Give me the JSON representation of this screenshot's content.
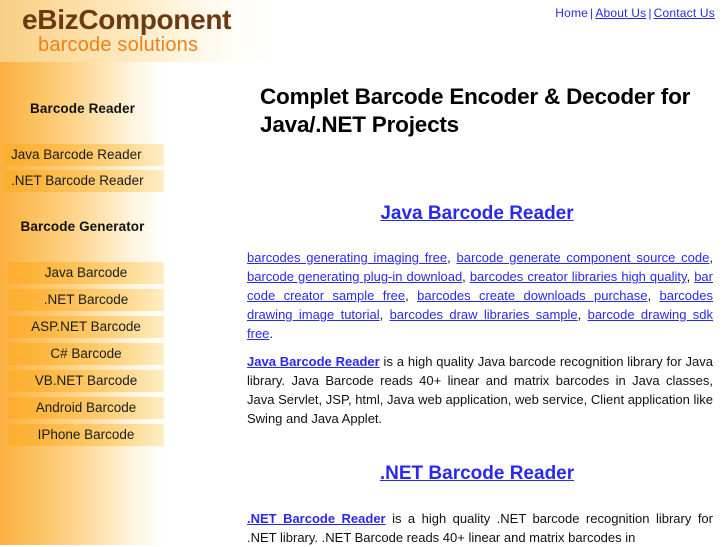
{
  "topnav": {
    "items": [
      {
        "label": "Home",
        "underlined": false
      },
      {
        "label": "About Us",
        "underlined": true
      },
      {
        "label": "Contact Us",
        "underlined": true
      }
    ],
    "separator": "|"
  },
  "logo": {
    "main": "eBizComponent",
    "sub": "barcode solutions",
    "main_color": "#6b3a12",
    "sub_color": "#f28018"
  },
  "sidebar": {
    "reader_heading": "Barcode Reader",
    "reader_items": [
      {
        "label": "Java Barcode Reader"
      },
      {
        "label": ".NET Barcode Reader"
      }
    ],
    "generator_heading": "Barcode Generator",
    "generator_items": [
      {
        "label": "Java Barcode"
      },
      {
        "label": ".NET Barcode"
      },
      {
        "label": "ASP.NET Barcode"
      },
      {
        "label": "C# Barcode"
      },
      {
        "label": "VB.NET Barcode"
      },
      {
        "label": "Android Barcode"
      },
      {
        "label": "IPhone Barcode"
      }
    ],
    "accent_color": "#fdae2e"
  },
  "main": {
    "page_title": "Complet Barcode Encoder & Decoder for Java/.NET Projects",
    "java_section": {
      "heading": "Java Barcode Reader",
      "keywords": [
        "barcodes generating imaging free",
        "barcode generate component source code",
        "barcode generating plug-in download",
        "barcodes creator libraries high quality",
        "bar code creator sample free",
        "barcodes create downloads purchase",
        "barcodes drawing image tutorial",
        "barcodes draw libraries sample",
        "barcode drawing sdk free"
      ],
      "para_link": "Java Barcode Reader",
      "para_text": " is a high quality Java barcode recognition library for Java library. Java Barcode reads 40+ linear and matrix barcodes in Java classes, Java Servlet, JSP, html, Java web application, web service, Client application like Swing and Java Applet."
    },
    "net_section": {
      "heading": ".NET Barcode Reader",
      "para_link": ".NET Barcode Reader",
      "para_text": " is a high quality .NET barcode recognition library for .NET library. .NET Barcode reads 40+ linear and matrix barcodes in"
    },
    "link_color": "#2a2aee"
  }
}
